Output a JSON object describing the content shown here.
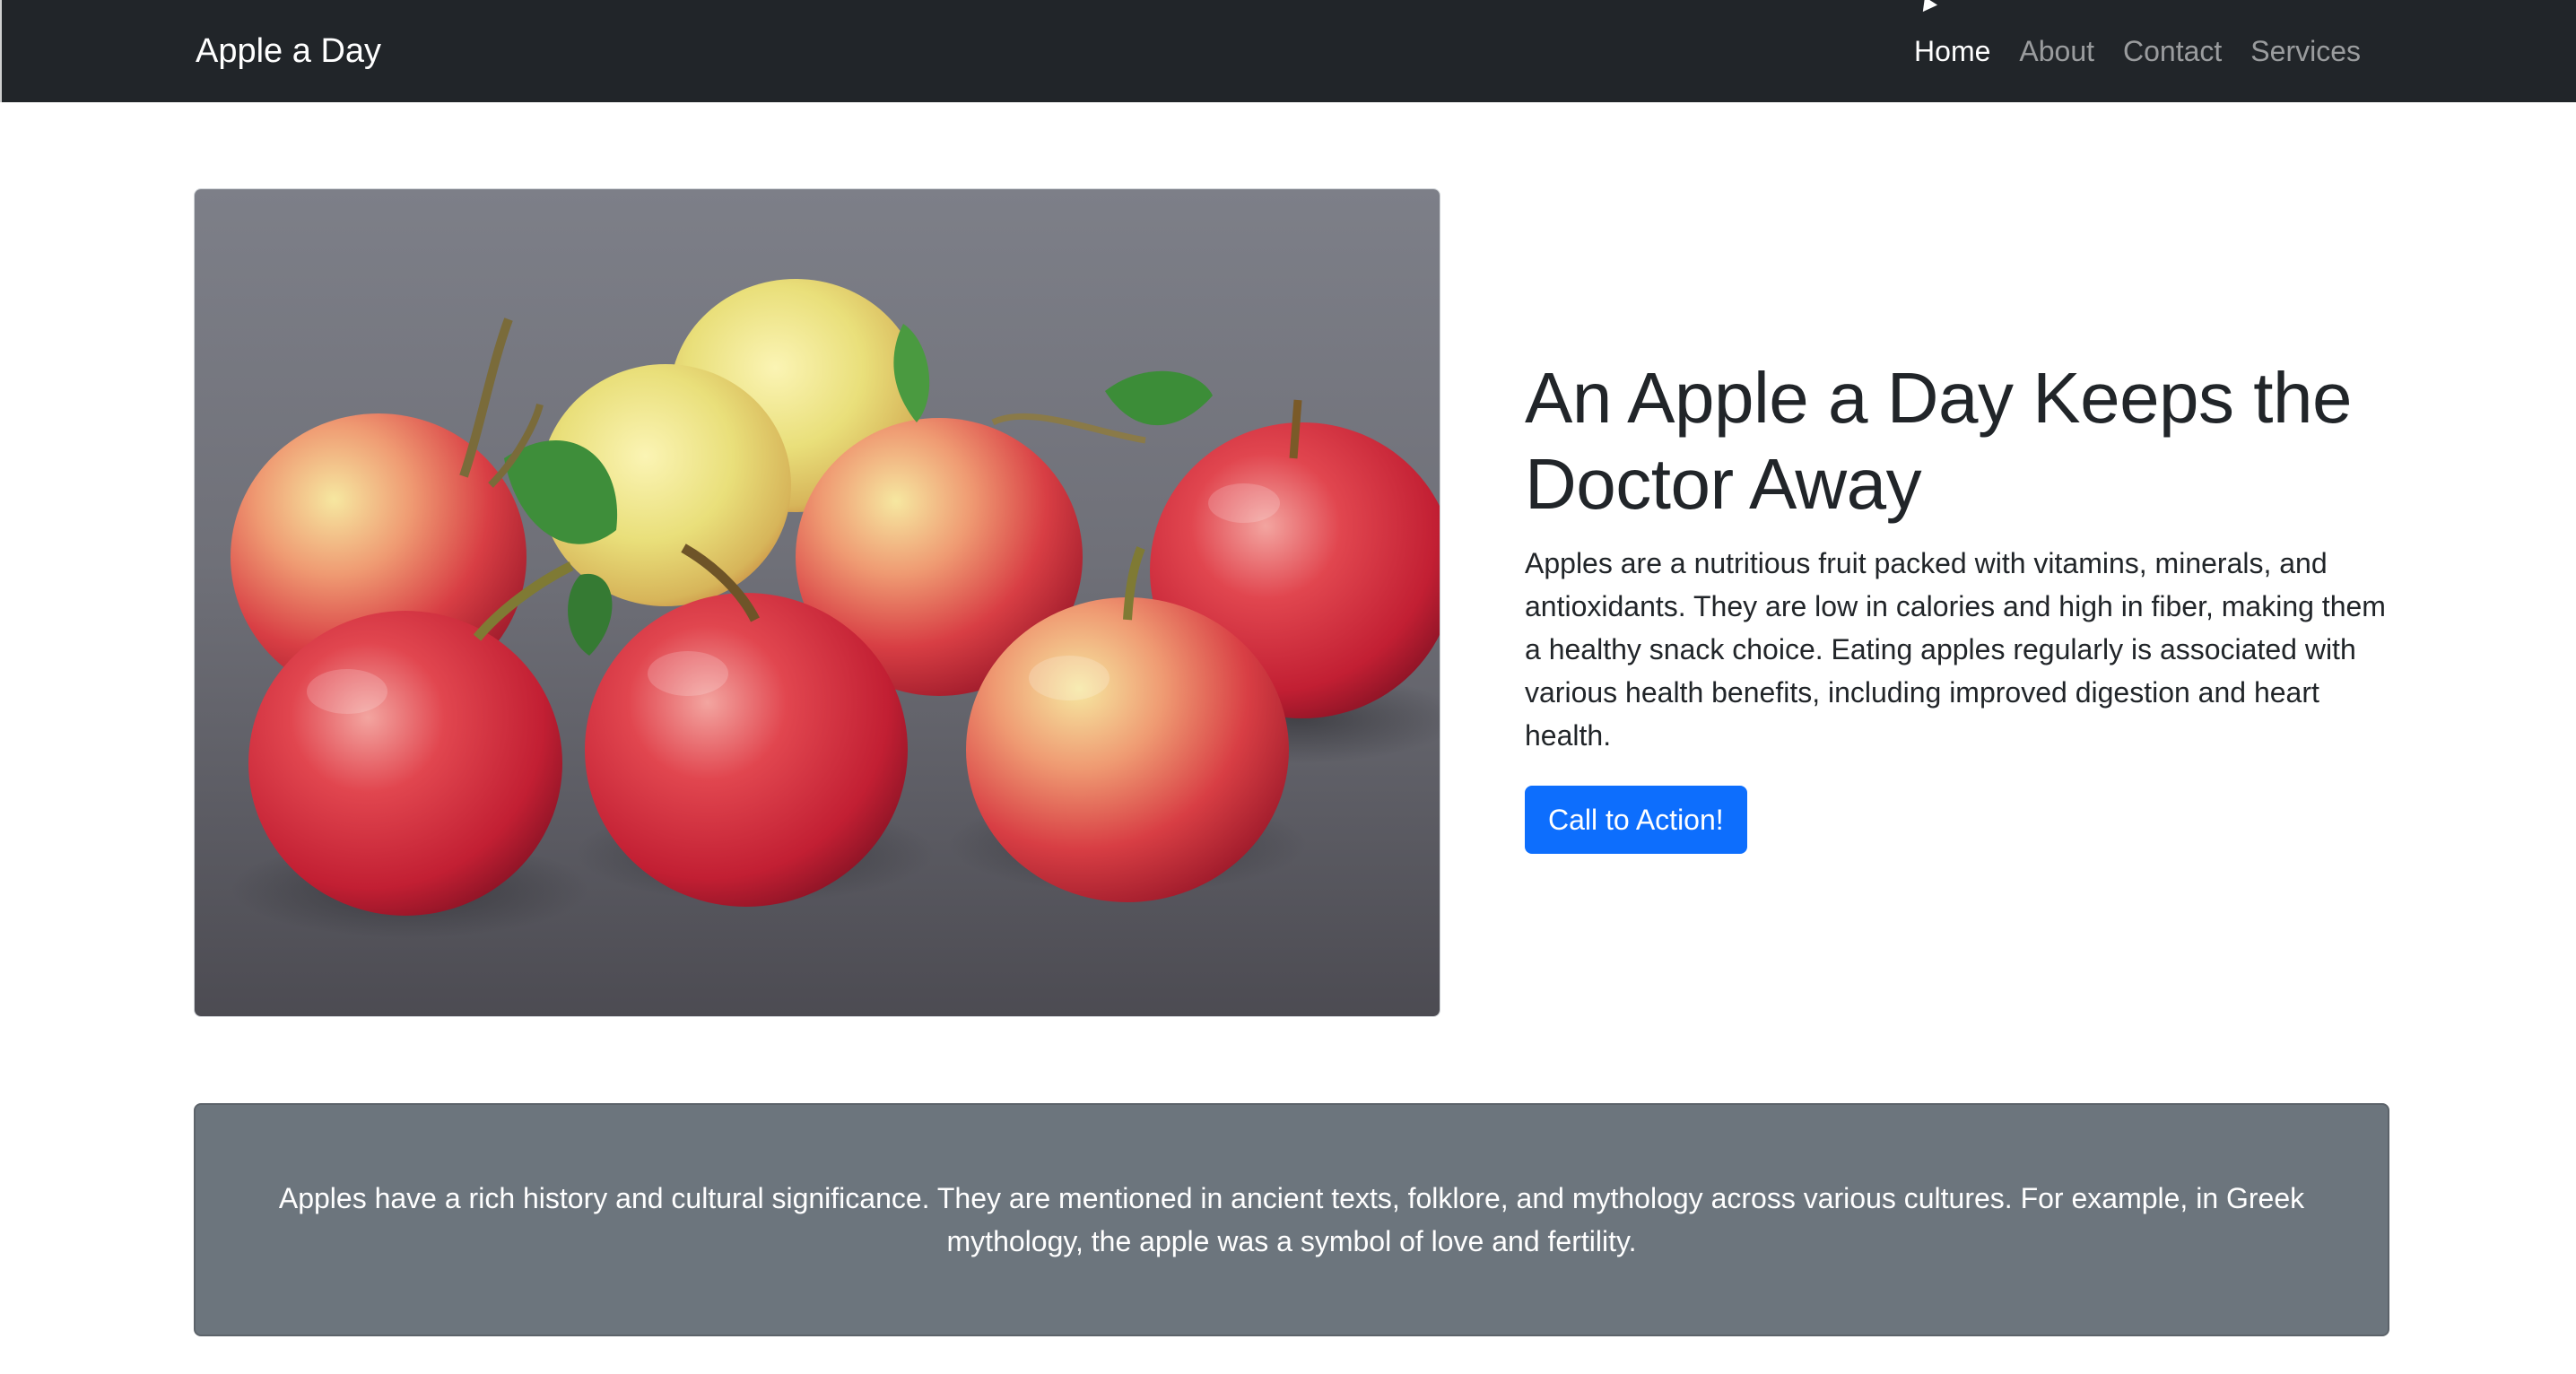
{
  "navbar": {
    "brand": "Apple a Day",
    "links": [
      {
        "label": "Home",
        "active": true
      },
      {
        "label": "About",
        "active": false
      },
      {
        "label": "Contact",
        "active": false
      },
      {
        "label": "Services",
        "active": false
      }
    ]
  },
  "hero": {
    "image_icon": "apples-photo",
    "title": "An Apple a Day Keeps the Doctor Away",
    "body": "Apples are a nutritious fruit packed with vitamins, minerals, and antioxidants. They are low in calories and high in fiber, making them a healthy snack choice. Eating apples regularly is associated with various health benefits, including improved digestion and heart health.",
    "cta_label": "Call to Action!"
  },
  "history": {
    "text": "Apples have a rich history and cultural significance. They are mentioned in ancient texts, folklore, and mythology across various cultures. For example, in Greek mythology, the apple was a symbol of love and fertility."
  },
  "colors": {
    "navbar_bg": "#212529",
    "primary": "#0d6efd",
    "card_bg": "#6c757d"
  }
}
